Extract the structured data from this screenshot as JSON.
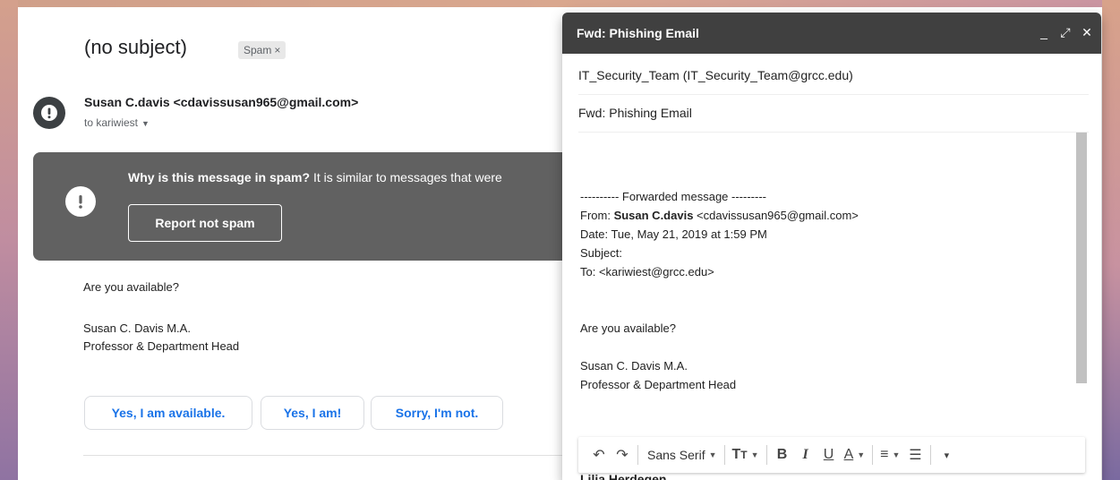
{
  "message": {
    "subject": "(no subject)",
    "spam_label": "Spam",
    "spam_chip_close": "×",
    "sender": "Susan C.davis <cdavissusan965@gmail.com>",
    "to_line": "to kariwiest",
    "spam_banner": {
      "why_bold": "Why is this message in spam?",
      "why_rest": " It is similar to messages that were",
      "report_button": "Report not spam"
    },
    "body": {
      "greeting": "Are you available?",
      "sig_name": "Susan C. Davis M.A.",
      "sig_title": "Professor & Department Head"
    },
    "smart_replies": [
      "Yes, I am available.",
      "Yes, I am!",
      "Sorry, I'm not."
    ]
  },
  "compose": {
    "title": "Fwd: Phishing Email",
    "minimize": "_",
    "expand": "⤢",
    "close": "✕",
    "to": "IT_Security_Team (IT_Security_Team@grcc.edu)",
    "subject": "Fwd: Phishing Email",
    "forwarded_header": "---------- Forwarded message ---------",
    "from_label": "From: ",
    "from_name": "Susan C.davis",
    "from_email": " <cdavissusan965@gmail.com>",
    "date": "Date: Tue, May 21, 2019 at 1:59 PM",
    "subject_line": "Subject:",
    "to_line": "To: <kariwiest@grcc.edu>",
    "greeting": "Are you available?",
    "sig_name": "Susan C. Davis M.A.",
    "sig_title": "Professor & Department Head",
    "clipped_name": "Lilia Herdegen"
  },
  "toolbar": {
    "undo": "↶",
    "redo": "↷",
    "font": "Sans Serif",
    "size": "T",
    "bold": "B",
    "italic": "I",
    "underline": "U",
    "text_color": "A",
    "align": "≡",
    "numbered_list": "☰",
    "more": "▾"
  }
}
